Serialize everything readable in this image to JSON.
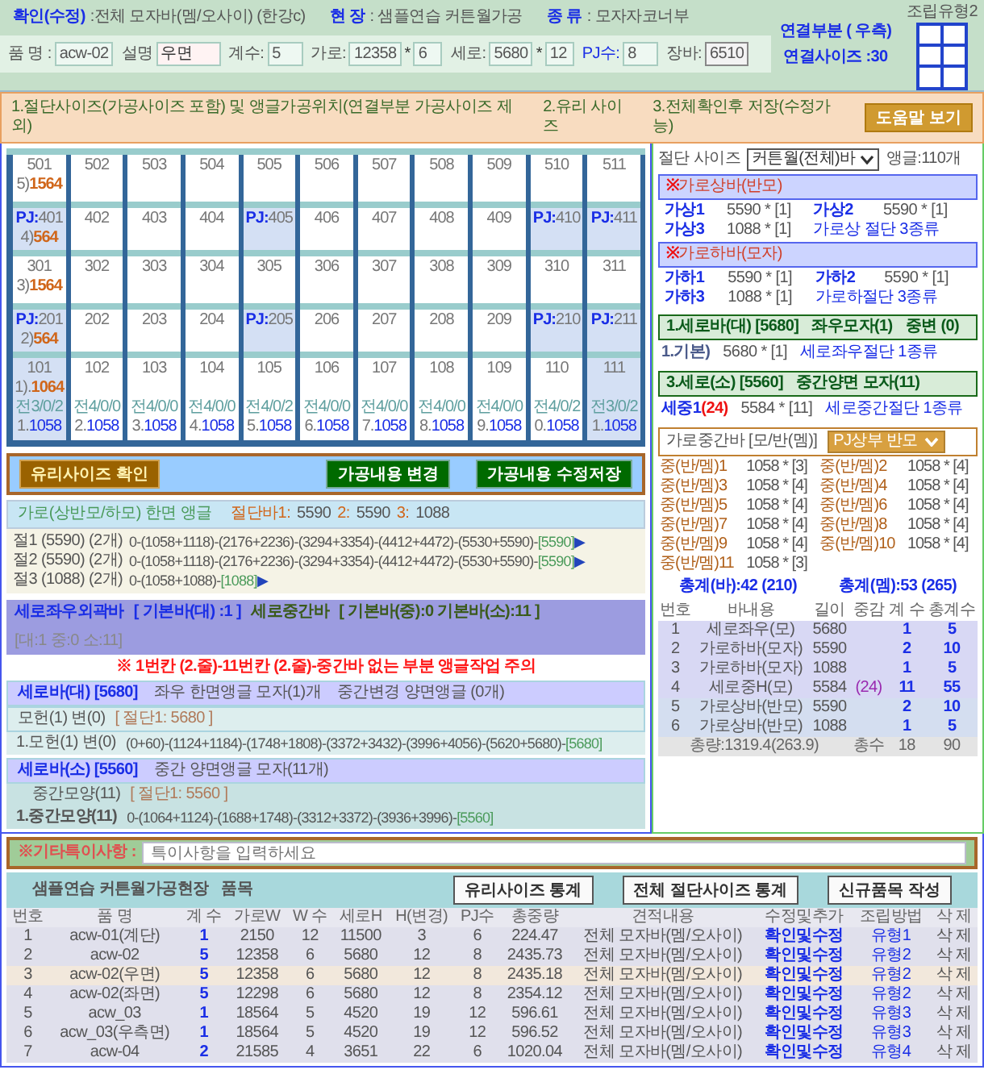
{
  "header": {
    "confirm": {
      "label": "확인(수정)",
      "value": ":전체 모자바(멤/오사이) (한강c)"
    },
    "site": {
      "label": "현 장",
      "value": ": 샘플연습 커튼월가공"
    },
    "type": {
      "label": "종 류",
      "value": ": 모자자코너부"
    }
  },
  "fields": [
    {
      "label": "품 명 :",
      "value": "acw-02",
      "kind": "plain"
    },
    {
      "label": "설명",
      "value": "우면",
      "kind": "note"
    },
    {
      "label": "계수:",
      "value": "5",
      "kind": "plain"
    },
    {
      "label": "가로:",
      "value": "12358",
      "times": "*",
      "value2": "6",
      "kind": "plain"
    },
    {
      "label": "세로:",
      "value": "5680",
      "times": "*",
      "value2": "12",
      "kind": "plain"
    },
    {
      "label": "PJ수:",
      "value": "8",
      "kind": "plain"
    },
    {
      "label": "장바:",
      "value": "6510",
      "kind": "readonly"
    }
  ],
  "connection": {
    "title": "연결부분 ( 우측)",
    "size": "연결사이즈 :30"
  },
  "assembly": {
    "label": "조립유형2"
  },
  "steps": [
    "1.절단사이즈(가공사이즈 포함) 및 앵글가공위치(연결부분 가공사이즈 제외)",
    "2.유리 사이즈",
    "3.전체확인후 저장(수정가능)"
  ],
  "help_button": "도움말 보기",
  "grid": {
    "rows": [
      {
        "kind": "tall",
        "cells": [
          {
            "number": "501",
            "highlighted": false,
            "note_prefix": "5)",
            "note_value": "1564"
          },
          {
            "number": "502",
            "highlighted": false
          },
          {
            "number": "503",
            "highlighted": false
          },
          {
            "number": "504",
            "highlighted": false
          },
          {
            "number": "505",
            "highlighted": false
          },
          {
            "number": "506",
            "highlighted": false
          },
          {
            "number": "507",
            "highlighted": false
          },
          {
            "number": "508",
            "highlighted": false
          },
          {
            "number": "509",
            "highlighted": false
          },
          {
            "number": "510",
            "highlighted": false
          },
          {
            "number": "511",
            "highlighted": false
          }
        ]
      },
      {
        "kind": "short",
        "cells": [
          {
            "tag": "PJ:",
            "number": "401",
            "highlighted": true,
            "note_prefix": "4)",
            "note_value": "564"
          },
          {
            "number": "402",
            "highlighted": false
          },
          {
            "number": "403",
            "highlighted": false
          },
          {
            "number": "404",
            "highlighted": false
          },
          {
            "tag": "PJ:",
            "number": "405",
            "highlighted": true
          },
          {
            "number": "406",
            "highlighted": false
          },
          {
            "number": "407",
            "highlighted": false
          },
          {
            "number": "408",
            "highlighted": false
          },
          {
            "number": "409",
            "highlighted": false
          },
          {
            "tag": "PJ:",
            "number": "410",
            "highlighted": true
          },
          {
            "tag": "PJ:",
            "number": "411",
            "highlighted": true
          }
        ]
      },
      {
        "kind": "tall",
        "cells": [
          {
            "number": "301",
            "highlighted": false,
            "note_prefix": "3)",
            "note_value": "1564"
          },
          {
            "number": "302",
            "highlighted": false
          },
          {
            "number": "303",
            "highlighted": false
          },
          {
            "number": "304",
            "highlighted": false
          },
          {
            "number": "305",
            "highlighted": false
          },
          {
            "number": "306",
            "highlighted": false
          },
          {
            "number": "307",
            "highlighted": false
          },
          {
            "number": "308",
            "highlighted": false
          },
          {
            "number": "309",
            "highlighted": false
          },
          {
            "number": "310",
            "highlighted": false
          },
          {
            "number": "311",
            "highlighted": false
          }
        ]
      },
      {
        "kind": "short",
        "cells": [
          {
            "tag": "PJ:",
            "number": "201",
            "highlighted": true,
            "note_prefix": "2)",
            "note_value": "564"
          },
          {
            "number": "202",
            "highlighted": false
          },
          {
            "number": "203",
            "highlighted": false
          },
          {
            "number": "204",
            "highlighted": false
          },
          {
            "tag": "PJ:",
            "number": "205",
            "highlighted": true
          },
          {
            "number": "206",
            "highlighted": false
          },
          {
            "number": "207",
            "highlighted": false
          },
          {
            "number": "208",
            "highlighted": false
          },
          {
            "number": "209",
            "highlighted": false
          },
          {
            "tag": "PJ:",
            "number": "210",
            "highlighted": true
          },
          {
            "tag": "PJ:",
            "number": "211",
            "highlighted": true
          }
        ]
      },
      {
        "kind": "base",
        "cells": [
          {
            "number": "101",
            "highlighted": true,
            "note_prefix": "1).",
            "note_value": "1064",
            "code": "전3/0/2",
            "idx": "1.",
            "val": "1058"
          },
          {
            "number": "102",
            "highlighted": false,
            "code": "전4/0/0",
            "idx": "2.",
            "val": "1058"
          },
          {
            "number": "103",
            "highlighted": false,
            "code": "전4/0/0",
            "idx": "3.",
            "val": "1058"
          },
          {
            "number": "104",
            "highlighted": false,
            "code": "전4/0/0",
            "idx": "4.",
            "val": "1058"
          },
          {
            "number": "105",
            "highlighted": false,
            "code": "전4/0/2",
            "idx": "5.",
            "val": "1058"
          },
          {
            "number": "106",
            "highlighted": false,
            "code": "전4/0/0",
            "idx": "6.",
            "val": "1058"
          },
          {
            "number": "107",
            "highlighted": false,
            "code": "전4/0/0",
            "idx": "7.",
            "val": "1058"
          },
          {
            "number": "108",
            "highlighted": false,
            "code": "전4/0/0",
            "idx": "8.",
            "val": "1058"
          },
          {
            "number": "109",
            "highlighted": false,
            "code": "전4/0/0",
            "idx": "9.",
            "val": "1058"
          },
          {
            "number": "110",
            "highlighted": false,
            "code": "전4/0/2",
            "idx": "0.",
            "val": "1058"
          },
          {
            "number": "111",
            "highlighted": true,
            "code": "전3/0/2",
            "idx": "1.",
            "val": "1058"
          }
        ]
      }
    ]
  },
  "actions": [
    {
      "label": "유리사이즈 확인",
      "kind": "brown"
    },
    {
      "label": "가공내용 변경",
      "kind": "green"
    },
    {
      "label": "가공내용 수정저장",
      "kind": "green"
    }
  ],
  "horizontal_cut": {
    "title": "가로(상반모/하모)  한면 앵글",
    "cuts": [
      {
        "label": "절단바1:",
        "value": "5590"
      },
      {
        "label": "2:",
        "value": "5590"
      },
      {
        "label": "3:",
        "value": "1088"
      }
    ],
    "lines": [
      {
        "label": "절1 (5590) (2개)",
        "sequence": "0-(1058+1118)-(2176+2236)-(3294+3354)-(4412+4472)-(5530+5590)-",
        "end": "[5590]",
        "arrow": "▶"
      },
      {
        "label": "절2 (5590) (2개)",
        "sequence": "0-(1058+1118)-(2176+2236)-(3294+3354)-(4412+4472)-(5530+5590)-",
        "end": "[5590]",
        "arrow": "▶"
      },
      {
        "label": "절3 (1088) (2개)",
        "sequence": "0-(1058+1088)-",
        "end": "[1088]",
        "arrow": "▶"
      }
    ]
  },
  "vertical_summary": {
    "outer_title": "세로좌우외곽바",
    "outer_base": "[ 기본바(대) :1 ]",
    "middle_title": "세로중간바",
    "middle_base": "[ 기본바(중):0  기본바(소):11 ]",
    "totals": "[대:1  중:0  소:11]"
  },
  "warning": "※ 1번칸 (2.줄)-11번칸 (2.줄)-중간바 없는 부분 앵글작업 주의",
  "vertical_bars": [
    {
      "title": "세로바(대) [5680]",
      "descriptions": [
        "좌우 한면앵글 모자(1)개",
        "중간변경 양면앵글 (0개)"
      ],
      "spec_label": "모헌(1) 변(0)",
      "spec_cut": "[ 절단1: 5680 ]",
      "line_label": "1.모헌(1) 변(0)",
      "sequence": "(0+60)-(1124+1184)-(1748+1808)-(3372+3432)-(3996+4056)-(5620+5680)-",
      "end": "[5680]"
    },
    {
      "title": "세로바(소) [5560]",
      "descriptions": [
        "중간 양면앵글  모자(11개)"
      ],
      "spec_label": "중간모양(11)",
      "spec_cut": "[ 절단1: 5560 ]",
      "line_label": "1.중간모양(11)",
      "sequence": "0-(1064+1124)-(1688+1748)-(3312+3372)-(3936+3996)-",
      "end": "[5560]"
    }
  ],
  "cut_panel": {
    "label": "절단 사이즈",
    "select": "커튼월(전체)바",
    "angle": "앵글:110개"
  },
  "horizontal_bars": [
    {
      "mark": "※",
      "title": "가로상바(반모)",
      "items": [
        {
          "name": "가상1",
          "value": "5590 * [1]"
        },
        {
          "name": "가상2",
          "value": "5590 * [1]"
        },
        {
          "name": "가상3",
          "value": "1088 * [1]"
        }
      ],
      "summary": "가로상 절단 3종류"
    },
    {
      "mark": "※",
      "title": "가로하바(모자)",
      "items": [
        {
          "name": "가하1",
          "value": "5590 * [1]"
        },
        {
          "name": "가하2",
          "value": "5590 * [1]"
        },
        {
          "name": "가하3",
          "value": "1088 * [1]"
        }
      ],
      "summary": "가로하절단 3종류"
    }
  ],
  "side_vertical": [
    {
      "title": "1.세로바(대) [5680]",
      "notes": [
        "좌우모자(1)",
        "중변 (0)"
      ],
      "name": "1.기본)",
      "value": "5680 * [1]",
      "summary": "세로좌우절단 1종류"
    },
    {
      "title": "3.세로(소) [5560]",
      "notes": [
        "중간양면 모자(11)"
      ],
      "name": "세중1",
      "count": "(24)",
      "value": "5584 * [11]",
      "summary": "세로중간절단 1종류"
    }
  ],
  "middle_bars": {
    "title": "가로중간바 [모/반(멤)]",
    "select": "PJ상부 반모",
    "items": [
      {
        "name": "중(반/멤)1",
        "value": "1058 * [3]"
      },
      {
        "name": "중(반/멤)2",
        "value": "1058 * [4]"
      },
      {
        "name": "중(반/멤)3",
        "value": "1058 * [4]"
      },
      {
        "name": "중(반/멤)4",
        "value": "1058 * [4]"
      },
      {
        "name": "중(반/멤)5",
        "value": "1058 * [4]"
      },
      {
        "name": "중(반/멤)6",
        "value": "1058 * [4]"
      },
      {
        "name": "중(반/멤)7",
        "value": "1058 * [4]"
      },
      {
        "name": "중(반/멤)8",
        "value": "1058 * [4]"
      },
      {
        "name": "중(반/멤)9",
        "value": "1058 * [4]"
      },
      {
        "name": "중(반/멤)10",
        "value": "1058 * [4]"
      },
      {
        "name": "중(반/멤)11",
        "value": "1058 * [3]"
      }
    ],
    "totals": [
      "총계(바):42  (210)",
      "총계(멤):53  (265)"
    ]
  },
  "bar_table": {
    "columns": [
      "번호",
      "바내용",
      "길이",
      "중감",
      "계 수",
      "총계수"
    ],
    "rows": [
      {
        "no": "1",
        "name": "세로좌우(모)",
        "length": "5680",
        "count": "1",
        "total": "5"
      },
      {
        "no": "2",
        "name": "가로하바(모자)",
        "length": "5590",
        "count": "2",
        "total": "10"
      },
      {
        "no": "3",
        "name": "가로하바(모자)",
        "length": "1088",
        "count": "1",
        "total": "5"
      },
      {
        "no": "4",
        "name": "세로중H(모)",
        "length": "5584",
        "diff": "(24)",
        "count": "11",
        "total": "55"
      },
      {
        "no": "5",
        "name": "가로상바(반모)",
        "length": "5590",
        "count": "2",
        "total": "10"
      },
      {
        "no": "6",
        "name": "가로상바(반모)",
        "length": "1088",
        "count": "1",
        "total": "5"
      }
    ],
    "footer": {
      "weight": "총량:1319.4(263.9)",
      "label": "총수",
      "count": "18",
      "total": "90"
    }
  },
  "memo": {
    "label": "※기타특이사항 :",
    "placeholder": "특이사항을 입력하세요"
  },
  "items_table": {
    "title": "샘플연습 커튼월가공현장",
    "subtitle": "품목",
    "buttons": [
      "유리사이즈 통계",
      "전체 절단사이즈 통계",
      "신규품목 작성"
    ],
    "columns": [
      "번호",
      "품 명",
      "계 수",
      "가로W",
      "W 수",
      "세로H",
      "H(변경)",
      "PJ수",
      "총중량",
      "견적내용",
      "수정및추가",
      "조립방법",
      "삭 제"
    ],
    "rows": [
      {
        "selected": false,
        "cells": [
          "1",
          "acw-01(계단)",
          "1",
          "2150",
          "12",
          "11500",
          "3",
          "6",
          "224.47",
          "전체 모자바(멤/오사이)",
          "확인및수정",
          "유형1",
          "삭 제"
        ]
      },
      {
        "selected": false,
        "cells": [
          "2",
          "acw-02",
          "5",
          "12358",
          "6",
          "5680",
          "12",
          "8",
          "2435.73",
          "전체 모자바(멤/오사이)",
          "확인및수정",
          "유형2",
          "삭 제"
        ]
      },
      {
        "selected": true,
        "cells": [
          "3",
          "acw-02(우면)",
          "5",
          "12358",
          "6",
          "5680",
          "12",
          "8",
          "2435.18",
          "전체 모자바(멤/오사이)",
          "확인및수정",
          "유형2",
          "삭 제"
        ]
      },
      {
        "selected": false,
        "cells": [
          "4",
          "acw-02(좌면)",
          "5",
          "12298",
          "6",
          "5680",
          "12",
          "8",
          "2354.12",
          "전체 모자바(멤/오사이)",
          "확인및수정",
          "유형2",
          "삭 제"
        ]
      },
      {
        "selected": false,
        "cells": [
          "5",
          "acw_03",
          "1",
          "18564",
          "5",
          "4520",
          "19",
          "12",
          "596.61",
          "전체 모자바(멤/오사이)",
          "확인및수정",
          "유형3",
          "삭 제"
        ]
      },
      {
        "selected": false,
        "cells": [
          "6",
          "acw_03(우측면)",
          "1",
          "18564",
          "5",
          "4520",
          "19",
          "12",
          "596.52",
          "전체 모자바(멤/오사이)",
          "확인및수정",
          "유형3",
          "삭 제"
        ]
      },
      {
        "selected": false,
        "cells": [
          "7",
          "acw-04",
          "2",
          "21585",
          "4",
          "3651",
          "22",
          "6",
          "1020.04",
          "전체 모자바(멤/오사이)",
          "확인및수정",
          "유형4",
          "삭 제"
        ]
      }
    ]
  }
}
